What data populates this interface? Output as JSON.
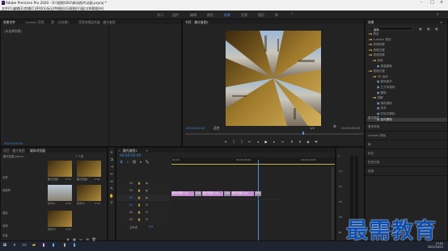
{
  "window": {
    "title": "Adobe Premiere Pro 2020 - D:\\视频\\002\\移动照片动画.prproj *"
  },
  "menu": [
    "文件(F)",
    "编辑(E)",
    "剪辑(C)",
    "序列(S)",
    "标记(M)",
    "图形(G)",
    "视图(V)",
    "窗口(W)",
    "帮助(H)"
  ],
  "workspaces": [
    {
      "label": "学习",
      "active": false
    },
    {
      "label": "组件",
      "active": false
    },
    {
      "label": "编辑",
      "active": false
    },
    {
      "label": "颜色",
      "active": false
    },
    {
      "label": "效果",
      "active": true
    },
    {
      "label": "音频",
      "active": false
    },
    {
      "label": "图形",
      "active": false
    },
    {
      "label": "库",
      "active": false
    }
  ],
  "source_panel": {
    "tabs": [
      "效果控件",
      "Lumetri 范围",
      "源：(无剪辑)",
      "音频剪辑混合器：趣光复图"
    ],
    "empty_msg": "(未选择剪辑)",
    "time": "00:00:00:00"
  },
  "program": {
    "tab": "节目：趣光复图1",
    "timecode": "00:00:00:00",
    "fit": "适合",
    "ratio": "1/2",
    "duration": "00:00:05:00"
  },
  "effects": {
    "title": "效果",
    "search_value": "旋转",
    "items": [
      {
        "label": "预设",
        "level": 0
      },
      {
        "label": "Lumetri 预设",
        "level": 0
      },
      {
        "label": "音频效果",
        "level": 0
      },
      {
        "label": "音频过渡",
        "level": 0
      },
      {
        "label": "视频效果",
        "level": 0
      },
      {
        "label": "变换",
        "level": 1
      },
      {
        "label": "垂直翻转",
        "level": 2
      },
      {
        "label": "视频过渡",
        "level": 0
      },
      {
        "label": "3D 运动",
        "level": 1
      },
      {
        "label": "旋转离开",
        "level": 2
      },
      {
        "label": "立方体旋转",
        "level": 2
      },
      {
        "label": "翻转",
        "level": 2
      },
      {
        "label": "溶解",
        "level": 1
      },
      {
        "label": "随机擦除",
        "level": 2
      },
      {
        "label": "风车",
        "level": 2
      },
      {
        "label": "时钟式擦除",
        "level": 2
      },
      {
        "label": "径向擦除",
        "level": 2
      }
    ],
    "selected_index": 16,
    "sections": [
      "基本图形",
      "基本声音",
      "Lumetri 颜色",
      "库",
      "标记",
      "历史记录",
      "信息"
    ]
  },
  "project": {
    "tabs": [
      "项目：趣光复图",
      "媒体浏览器"
    ],
    "name": "趣光复图.prproj",
    "count": "7 个项",
    "items": [
      {
        "label": "趣光复图1",
        "dur": "5:00"
      },
      {
        "label": "趣光复图2",
        "dur": "5:00"
      },
      {
        "label": "街景01",
        "dur": "5:00"
      },
      {
        "label": "街景02",
        "dur": "5:00"
      },
      {
        "label": "街景03",
        "dur": "5:00"
      }
    ],
    "sidebar": [
      "名称",
      "帧速率",
      "渲染",
      "音频",
      "字幕"
    ]
  },
  "timeline": {
    "tab": "趣光复图1",
    "timecode": "00:00:00:00",
    "ruler": [
      "00:00",
      "00:00:05:00",
      "00:00:10:00"
    ],
    "tracks": [
      "V3",
      "V2",
      "V1",
      "A1",
      "A2",
      "A3"
    ],
    "master": "主声道",
    "master_val": "0.0",
    "clips": [
      {
        "label": "趣光复图2.jpg"
      },
      {
        "label": "风车"
      },
      {
        "label": "趣光复图3.jpg"
      },
      {
        "label": "风车"
      },
      {
        "label": "趣光复图4.jpg"
      },
      {
        "label": "风车"
      }
    ]
  },
  "audio_meter": {
    "labels": [
      "0",
      "-12",
      "-24",
      "-36",
      "-48",
      "dB"
    ]
  },
  "watermark": "最需教育",
  "taskbar": {
    "time": "15:03",
    "date": "2021/10/15"
  }
}
